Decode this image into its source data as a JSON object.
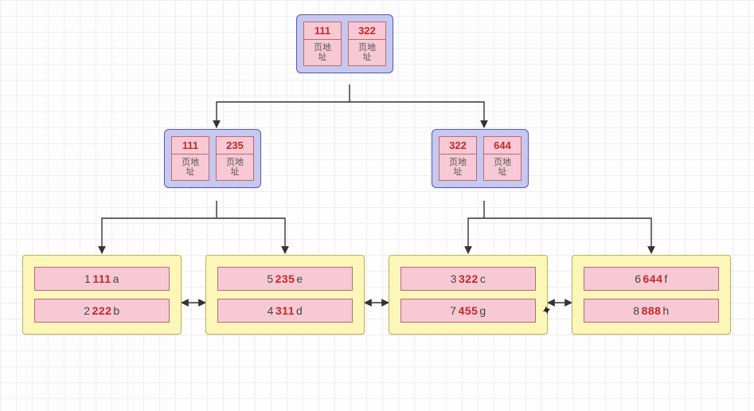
{
  "page_address_label": "页地\n址",
  "root": {
    "cells": [
      {
        "key": "111"
      },
      {
        "key": "322"
      }
    ]
  },
  "internals": [
    {
      "id": "left",
      "cells": [
        {
          "key": "111"
        },
        {
          "key": "235"
        }
      ]
    },
    {
      "id": "right",
      "cells": [
        {
          "key": "322"
        },
        {
          "key": "644"
        }
      ]
    }
  ],
  "leaves": [
    {
      "rows": [
        {
          "prefix": "1",
          "key": "111",
          "suffix": "a"
        },
        {
          "prefix": "2",
          "key": "222",
          "suffix": "b"
        }
      ]
    },
    {
      "rows": [
        {
          "prefix": "5",
          "key": "235",
          "suffix": "e"
        },
        {
          "prefix": "4",
          "key": "311",
          "suffix": "d"
        }
      ]
    },
    {
      "rows": [
        {
          "prefix": "3",
          "key": "322",
          "suffix": "c"
        },
        {
          "prefix": "7",
          "key": "455",
          "suffix": "g"
        }
      ]
    },
    {
      "rows": [
        {
          "prefix": "6",
          "key": "644",
          "suffix": "f"
        },
        {
          "prefix": "8",
          "key": "888",
          "suffix": "h"
        }
      ]
    }
  ]
}
